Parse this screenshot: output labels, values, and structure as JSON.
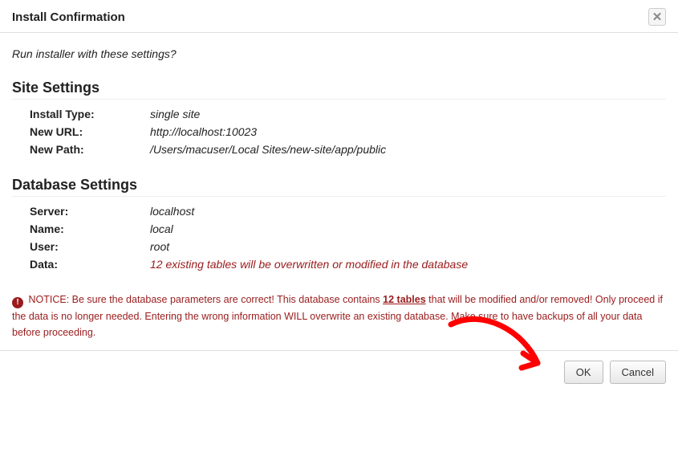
{
  "header": {
    "title": "Install Confirmation"
  },
  "prompt": "Run installer with these settings?",
  "site": {
    "title": "Site Settings",
    "rows": [
      {
        "label": "Install Type:",
        "value": "single site"
      },
      {
        "label": "New URL:",
        "value": "http://localhost:10023"
      },
      {
        "label": "New Path:",
        "value": "/Users/macuser/Local Sites/new-site/app/public"
      }
    ]
  },
  "database": {
    "title": "Database Settings",
    "rows": [
      {
        "label": "Server:",
        "value": "localhost"
      },
      {
        "label": "Name:",
        "value": "local"
      },
      {
        "label": "User:",
        "value": "root"
      },
      {
        "label": "Data:",
        "value": "12 existing tables will be overwritten or modified in the database",
        "warning": true
      }
    ]
  },
  "notice": {
    "prefix": "NOTICE: Be sure the database parameters are correct! This database contains ",
    "tables": "12 tables",
    "suffix": " that will be modified and/or removed! Only proceed if the data is no longer needed. Entering the wrong information WILL overwrite an existing database. Make sure to have backups of all your data before proceeding."
  },
  "buttons": {
    "ok": "OK",
    "cancel": "Cancel"
  },
  "colors": {
    "warning": "#9a1c1c",
    "arrow": "#ff0000"
  }
}
